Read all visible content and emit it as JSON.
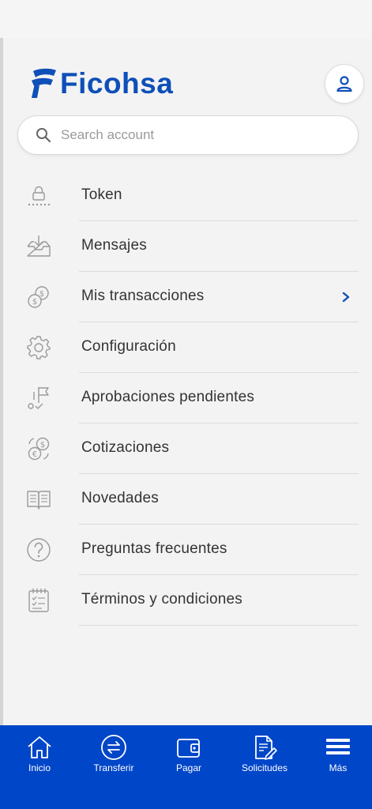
{
  "colors": {
    "brand": "#0e4fb8",
    "nav_bg": "#0046c8",
    "icon_gray": "#9a9a9a",
    "text": "#333333"
  },
  "header": {
    "logo_text": "Ficohsa",
    "profile_icon": "user-icon"
  },
  "search": {
    "placeholder": "Search account",
    "value": ""
  },
  "menu": {
    "items": [
      {
        "label": "Token",
        "icon": "lock-icon"
      },
      {
        "label": "Mensajes",
        "icon": "inbox-icon"
      },
      {
        "label": "Mis transacciones",
        "icon": "coins-icon",
        "has_chevron": true
      },
      {
        "label": "Configuración",
        "icon": "gear-icon"
      },
      {
        "label": "Aprobaciones pendientes",
        "icon": "flag-check-icon"
      },
      {
        "label": "Cotizaciones",
        "icon": "currency-exchange-icon"
      },
      {
        "label": "Novedades",
        "icon": "book-icon"
      },
      {
        "label": "Preguntas frecuentes",
        "icon": "question-icon"
      },
      {
        "label": "Términos y condiciones",
        "icon": "checklist-icon"
      }
    ]
  },
  "bottom_nav": {
    "items": [
      {
        "label": "Inicio",
        "icon": "home-icon"
      },
      {
        "label": "Transferir",
        "icon": "transfer-icon"
      },
      {
        "label": "Pagar",
        "icon": "wallet-icon"
      },
      {
        "label": "Solicitudes",
        "icon": "document-edit-icon"
      },
      {
        "label": "Más",
        "icon": "menu-icon"
      }
    ]
  }
}
